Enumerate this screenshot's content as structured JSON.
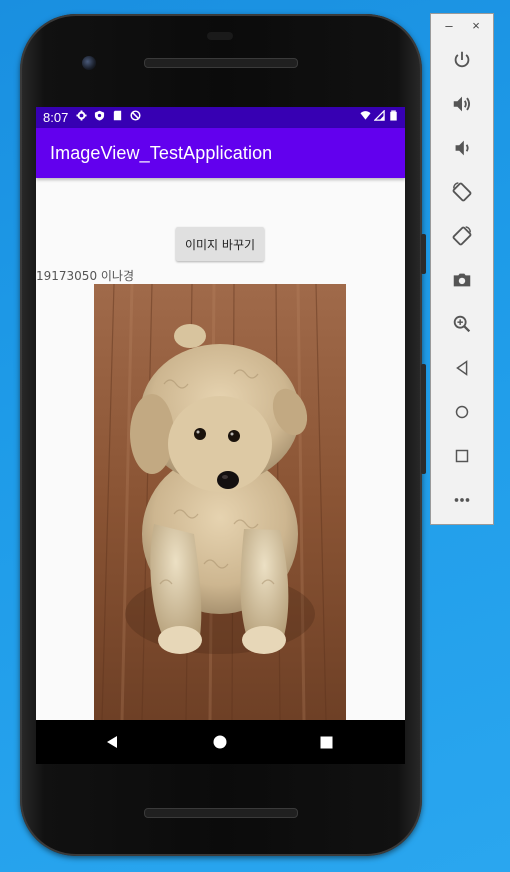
{
  "status_bar": {
    "time": "8:07",
    "left_icons": [
      "gear-icon",
      "shield-icon",
      "sd-card-icon",
      "no-disturb-icon"
    ],
    "right_icons": [
      "wifi-icon",
      "signal-icon",
      "battery-icon"
    ]
  },
  "app_bar": {
    "title": "ImageView_TestApplication"
  },
  "content": {
    "change_button_label": "이미지 바꾸기",
    "student_label": "19173050 이나경",
    "image": {
      "subject": "fluffy apricot poodle puppy lying on wooden floor"
    }
  },
  "nav_bar": {
    "buttons": [
      "back-icon",
      "home-icon",
      "recents-icon"
    ]
  },
  "emulator_panel": {
    "window_controls": {
      "minimize": "–",
      "close": "×"
    },
    "tools": [
      "power-icon",
      "volume-up-icon",
      "volume-down-icon",
      "rotate-left-icon",
      "rotate-right-icon",
      "camera-icon",
      "zoom-icon",
      "back-icon",
      "home-icon",
      "overview-icon",
      "more-icon"
    ]
  },
  "colors": {
    "status_bar": "#3700b3",
    "app_bar": "#6200ee",
    "desktop": "#1e9be8"
  }
}
